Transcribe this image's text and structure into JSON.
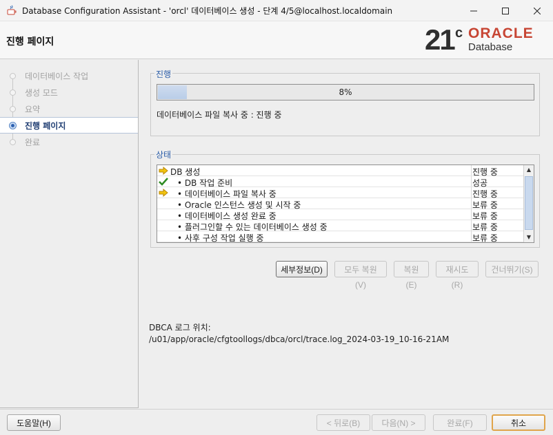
{
  "window": {
    "title": "Database Configuration Assistant - 'orcl' 데이터베이스 생성 - 단계 4/5@localhost.localdomain",
    "controls": {
      "minimize": "—",
      "maximize": "☐",
      "close": "✕"
    }
  },
  "header": {
    "page_title": "진행 페이지",
    "logo": {
      "version": "21",
      "version_suffix": "c",
      "brand": "ORACLE",
      "product": "Database"
    }
  },
  "steps": [
    {
      "label": "데이터베이스 작업",
      "state": "done"
    },
    {
      "label": "생성 모드",
      "state": "done"
    },
    {
      "label": "요약",
      "state": "done"
    },
    {
      "label": "진행 페이지",
      "state": "active"
    },
    {
      "label": "완료",
      "state": "pending"
    }
  ],
  "progress_section": {
    "title": "진행",
    "percent_value": 8,
    "percent_text": "8%",
    "status_text": "데이터베이스 파일 복사 중 : 진행 중"
  },
  "status_section": {
    "title": "상태",
    "rows": [
      {
        "name": "DB 생성",
        "state": "진행 중",
        "icon": "arrow-icon"
      },
      {
        "name": "• DB 작업 준비",
        "state": "성공",
        "icon": "checkmark-icon"
      },
      {
        "name": "• 데이터베이스 파일 복사 중",
        "state": "진행 중",
        "icon": "arrow-icon"
      },
      {
        "name": "• Oracle 인스턴스 생성 및 시작 중",
        "state": "보류 중",
        "icon": ""
      },
      {
        "name": "• 데이터베이스 생성 완료 중",
        "state": "보류 중",
        "icon": ""
      },
      {
        "name": "• 플러그인할 수 있는 데이터베이스 생성 중",
        "state": "보류 중",
        "icon": ""
      },
      {
        "name": "• 사후 구성 작업 실행 중",
        "state": "보류 중",
        "icon": ""
      }
    ]
  },
  "action_buttons": {
    "details": "세부정보(D)",
    "revert_all": "모두 복원(V)",
    "revert": "복원(E)",
    "retry": "재시도(R)",
    "skip": "건너뛰기(S)"
  },
  "log": {
    "label": "DBCA 로그 위치:",
    "path": "/u01/app/oracle/cfgtoollogs/dbca/orcl/trace.log_2024-03-19_10-16-21AM"
  },
  "footer": {
    "help": "도움말(H)",
    "back": "< 뒤로(B)",
    "next": "다음(N) >",
    "finish": "완료(F)",
    "cancel": "취소"
  },
  "colors": {
    "accent": "#2a5ca8",
    "oracle_red": "#c74634",
    "progress_fill": "#b9cde8",
    "check_green": "#2e8b22",
    "arrow_yellow": "#e8b400"
  }
}
